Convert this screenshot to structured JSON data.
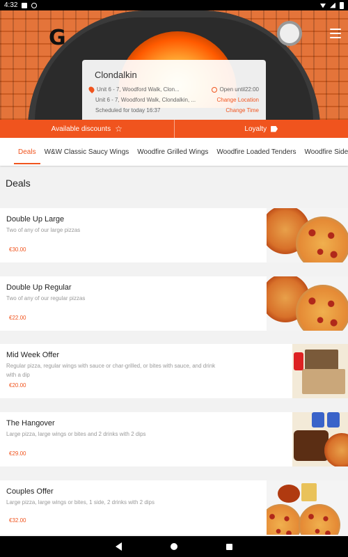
{
  "status_bar": {
    "time": "4:32"
  },
  "store": {
    "city": "Clondalkin",
    "address_short": "Unit 6 - 7, Woodford Walk, Clon...",
    "address_long": "Unit 6 - 7, Woodford Walk, Clondalkin, ...",
    "scheduled": "Scheduled for today 16:37",
    "open_status": "Open until22:00",
    "change_location": "Change Location",
    "change_time": "Change Time"
  },
  "actions": {
    "discounts_label": "Available discounts",
    "loyalty_label": "Loyalty"
  },
  "tabs": [
    {
      "label": "Deals"
    },
    {
      "label": "W&W Classic Saucy Wings"
    },
    {
      "label": "Woodfire Grilled Wings"
    },
    {
      "label": "Woodfire Loaded Tenders"
    },
    {
      "label": "Woodfire Sides"
    }
  ],
  "section_title": "Deals",
  "items": [
    {
      "name": "Double Up Large",
      "desc": "Two of any of our large pizzas",
      "price": "€30.00"
    },
    {
      "name": "Double Up Regular",
      "desc": "Two of any of our regular pizzas",
      "price": "€22.00"
    },
    {
      "name": "Mid Week Offer",
      "desc": "Regular pizza, regular wings with sauce or char-grilled, or bites with sauce, and drink with a dip",
      "price": "€20.00"
    },
    {
      "name": "The Hangover",
      "desc": "Large pizza, large wings or bites and 2 drinks with 2 dips",
      "price": "€29.00"
    },
    {
      "name": "Couples Offer",
      "desc": "Large pizza, large wings or bites, 1 side, 2 drinks with 2 dips",
      "price": "€32.00"
    }
  ],
  "colors": {
    "accent": "#f0541e",
    "price": "#f0541e"
  }
}
